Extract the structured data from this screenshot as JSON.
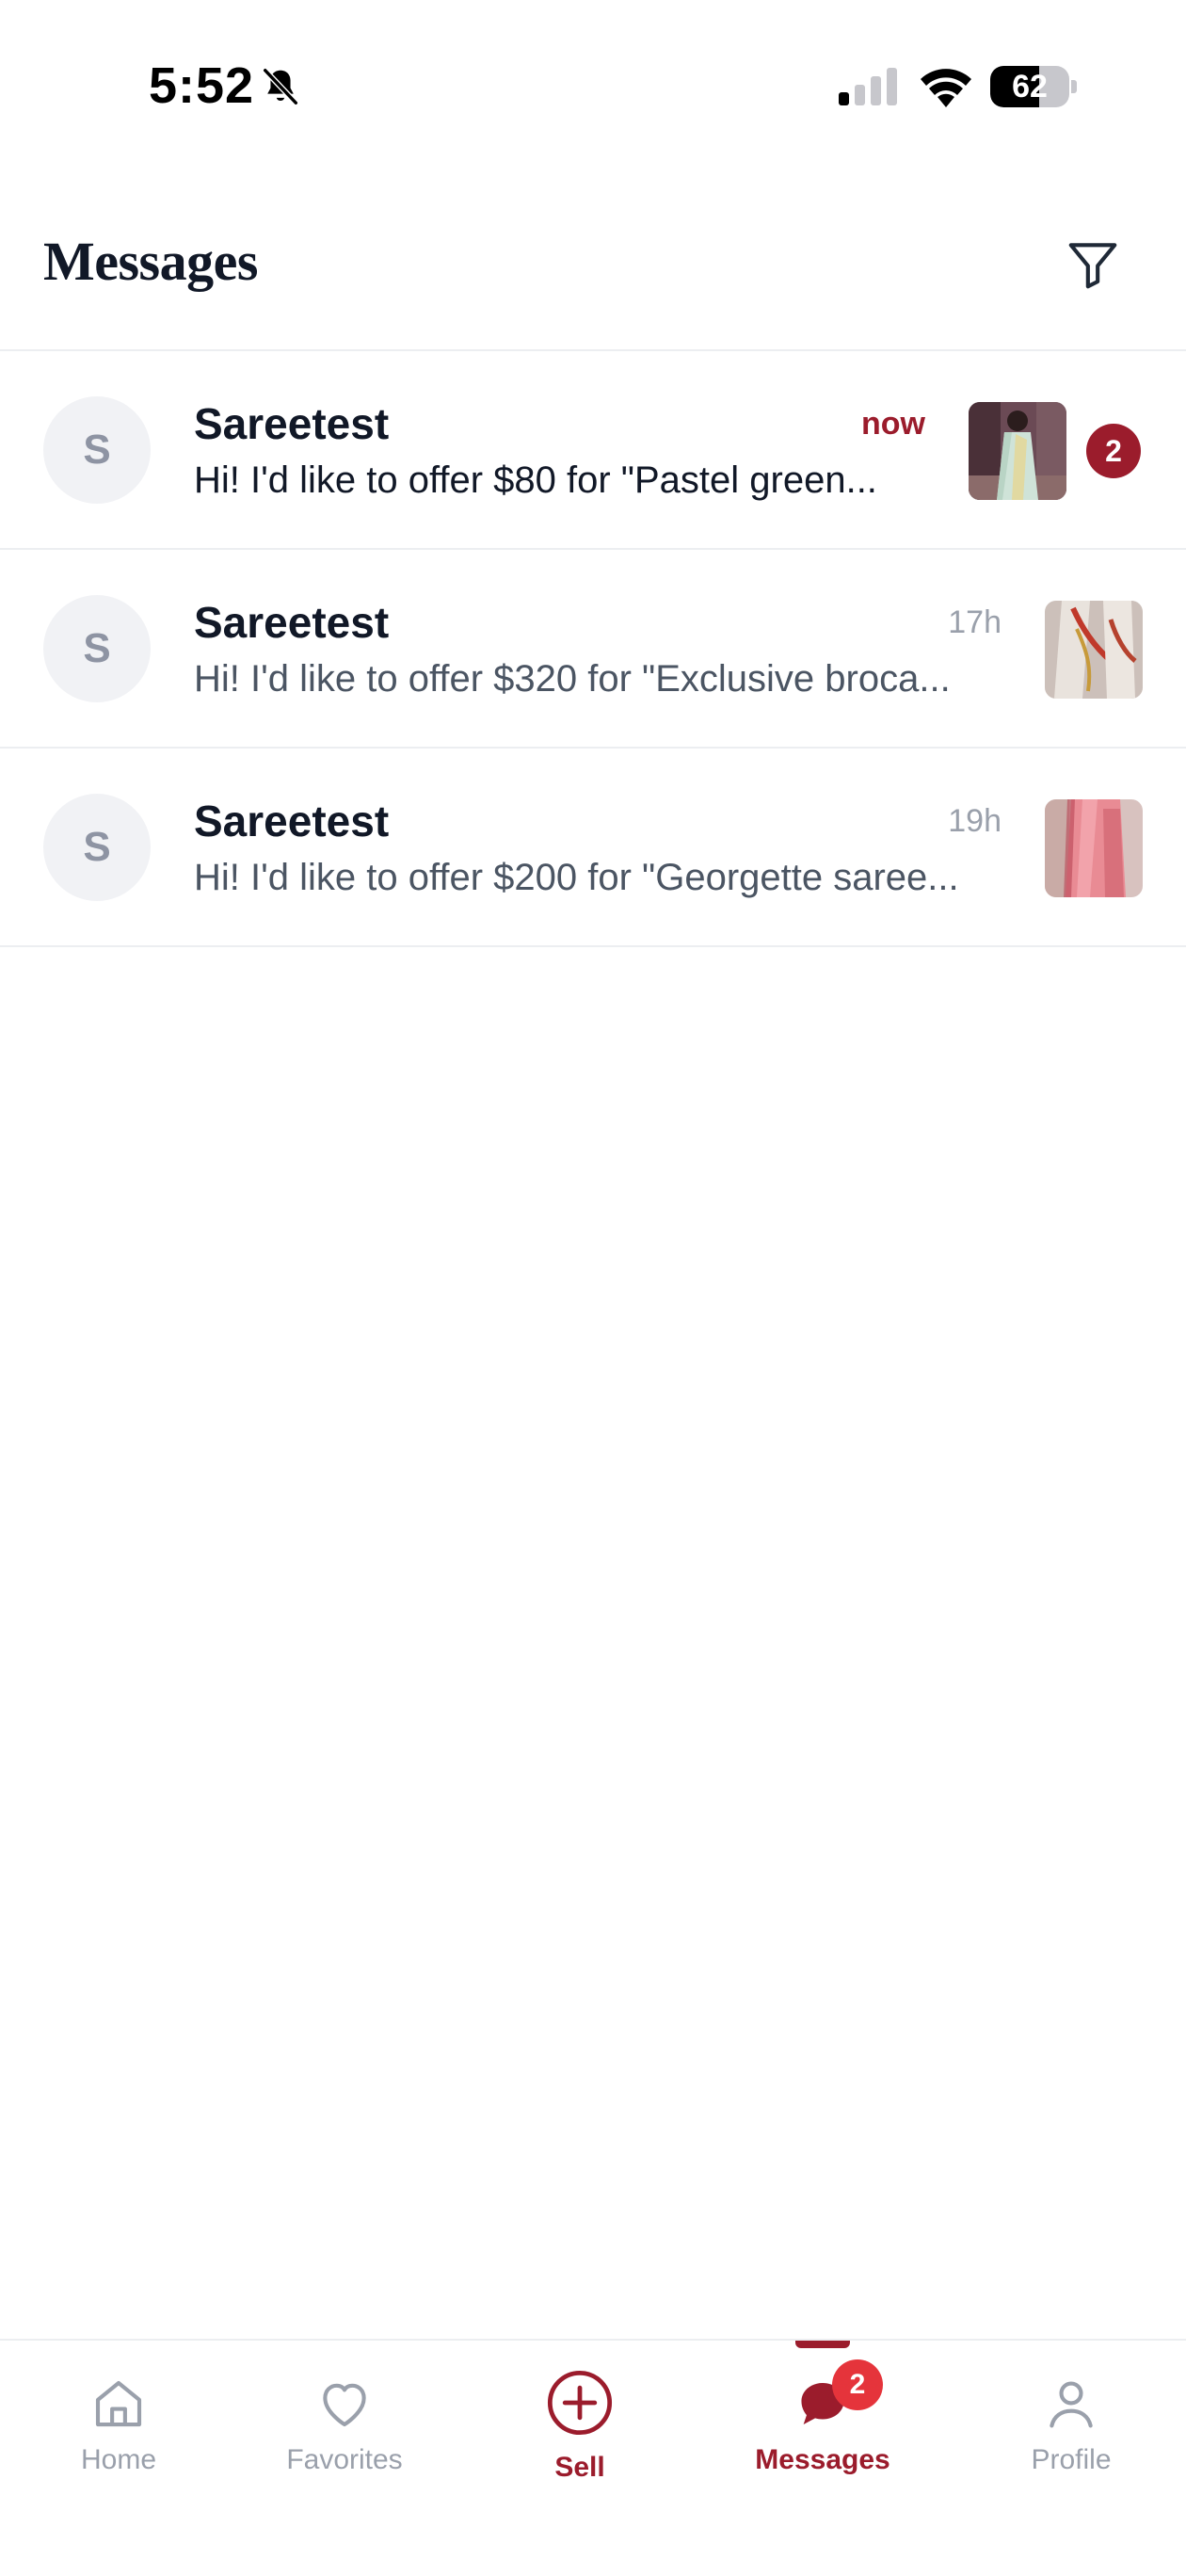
{
  "status_bar": {
    "time": "5:52",
    "battery_level": "62",
    "icons": [
      "bell-slash-icon",
      "cellular-signal-icon",
      "wifi-icon",
      "battery-icon"
    ]
  },
  "header": {
    "title": "Messages",
    "filter_icon": "filter-funnel-icon"
  },
  "conversations": [
    {
      "avatar_initial": "S",
      "name": "Sareetest",
      "time": "now",
      "preview": "Hi! I'd like to offer $80 for \"Pastel green...",
      "unread_count": "2",
      "thumbnail": "pastel-green-saree-photo"
    },
    {
      "avatar_initial": "S",
      "name": "Sareetest",
      "time": "17h",
      "preview": "Hi! I'd like to offer $320 for \"Exclusive broca...",
      "thumbnail": "brocade-saree-photo"
    },
    {
      "avatar_initial": "S",
      "name": "Sareetest",
      "time": "19h",
      "preview": "Hi! I'd like to offer $200 for \"Georgette saree...",
      "thumbnail": "georgette-saree-photo"
    }
  ],
  "tab_bar": {
    "tabs": [
      {
        "label": "Home",
        "icon": "home-icon"
      },
      {
        "label": "Favorites",
        "icon": "heart-icon"
      },
      {
        "label": "Sell",
        "icon": "plus-circle-icon"
      },
      {
        "label": "Messages",
        "icon": "chat-bubble-icon",
        "badge": "2",
        "active": true
      },
      {
        "label": "Profile",
        "icon": "person-icon"
      }
    ]
  },
  "colors": {
    "accent": "#9b1c2c",
    "badge_red": "#e5343b",
    "muted_text": "#9aa0ab",
    "divider": "#eceef1"
  }
}
